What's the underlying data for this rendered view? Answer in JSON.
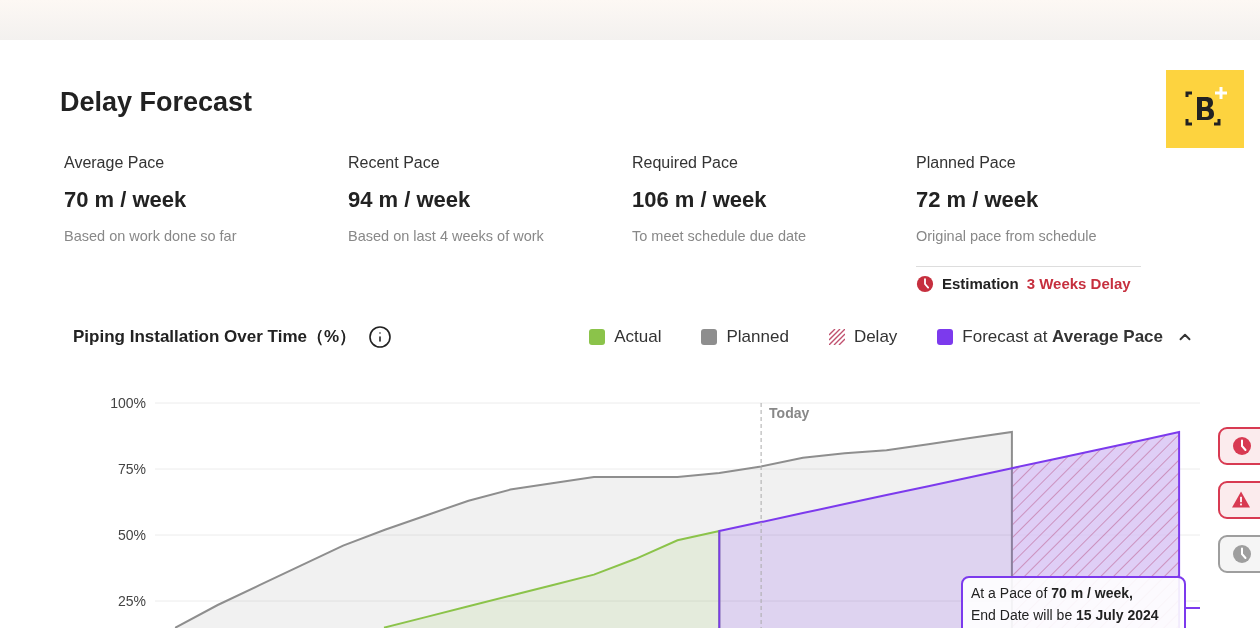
{
  "title": "Delay Forecast",
  "metrics": [
    {
      "label": "Average Pace",
      "value": "70 m / week",
      "note": "Based on work done so far"
    },
    {
      "label": "Recent Pace",
      "value": "94 m / week",
      "note": "Based on last 4 weeks of work"
    },
    {
      "label": "Required Pace",
      "value": "106 m / week",
      "note": "To meet schedule due date"
    },
    {
      "label": "Planned Pace",
      "value": "72 m / week",
      "note": "Original pace from schedule"
    }
  ],
  "estimation": {
    "label": "Estimation",
    "value": "3 Weeks Delay"
  },
  "chart_title": "Piping Installation Over Time（%）",
  "legend": [
    {
      "kind": "swatch",
      "label": "Actual",
      "color": "#8bc34a"
    },
    {
      "kind": "swatch",
      "label": "Planned",
      "color": "#8e8e8e"
    },
    {
      "kind": "hatch",
      "label": "Delay",
      "color": "#c0506e"
    },
    {
      "kind": "swatch",
      "label": "Forecast at **Average Pace**",
      "color": "#7c3aed",
      "expanded": true
    }
  ],
  "today": {
    "label": "Today"
  },
  "chart_data": {
    "type": "area",
    "grid": true,
    "ylim": [
      14.4,
      100
    ],
    "categories": [
      null,
      null,
      null,
      null,
      null,
      null,
      null,
      null,
      null,
      null,
      null,
      null,
      null,
      null,
      null,
      null,
      null,
      null,
      null,
      null,
      null,
      null,
      null,
      null,
      null
    ],
    "yticks": [
      {
        "value": 25,
        "label": "25%"
      },
      {
        "value": 50,
        "label": "50%"
      },
      {
        "value": 75,
        "label": "75%"
      },
      {
        "value": 100,
        "label": "100%"
      }
    ],
    "series": [
      {
        "color": "#8e8e8e",
        "values": [
          15,
          23.5,
          31,
          38.5,
          46,
          52,
          57.5,
          63,
          67.2,
          69.6,
          72,
          72,
          72,
          73.5,
          76,
          79.3,
          81,
          82.1,
          84.4,
          86.7,
          89,
          null,
          null,
          null,
          null
        ]
      },
      {
        "color": "#8bc34a",
        "values": [
          null,
          null,
          null,
          null,
          null,
          15,
          19,
          23,
          27,
          31,
          35,
          41,
          48,
          51.5,
          null,
          null,
          null,
          null,
          null,
          null,
          null,
          null,
          null,
          null,
          null
        ]
      },
      {
        "color": "#7c3aed",
        "values": [
          null,
          null,
          null,
          null,
          null,
          null,
          null,
          null,
          null,
          null,
          null,
          null,
          null,
          51.5,
          54.9,
          58.3,
          61.7,
          65.1,
          68.5,
          71.9,
          75.3,
          78.7,
          82.1,
          85.5,
          89
        ]
      }
    ]
  },
  "tooltip": [
    "At a Pace of **70 m / week,**",
    "End Date will be **15 July 2024**"
  ],
  "side_buttons": [
    {
      "kind": "clock",
      "color": "#d83a52"
    },
    {
      "kind": "warning",
      "color": "#d83a52"
    },
    {
      "kind": "clock",
      "color": "#9e9e9e"
    }
  ]
}
